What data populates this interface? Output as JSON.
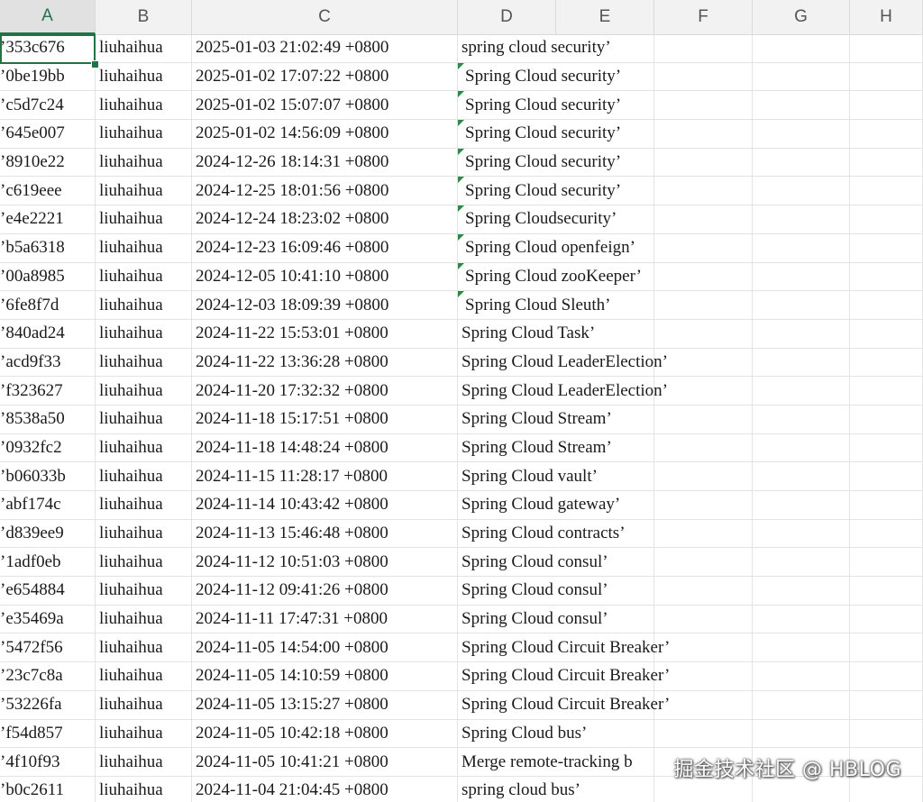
{
  "columns": [
    "A",
    "B",
    "C",
    "D",
    "E",
    "F",
    "G",
    "H"
  ],
  "active_column": "A",
  "rows": [
    {
      "a": "’353c676",
      "b": "liuhaihua",
      "c": "2025-01-03 21:02:49 +0800",
      "d": "spring cloud security’",
      "tri": false
    },
    {
      "a": "’0be19bb",
      "b": "liuhaihua",
      "c": "2025-01-02 17:07:22 +0800",
      "d": "Spring Cloud security’",
      "tri": true
    },
    {
      "a": "’c5d7c24",
      "b": "liuhaihua",
      "c": "2025-01-02 15:07:07 +0800",
      "d": "Spring Cloud security’",
      "tri": true
    },
    {
      "a": "’645e007",
      "b": "liuhaihua",
      "c": "2025-01-02 14:56:09 +0800",
      "d": "Spring Cloud security’",
      "tri": true
    },
    {
      "a": "’8910e22",
      "b": "liuhaihua",
      "c": "2024-12-26 18:14:31 +0800",
      "d": "Spring Cloud security’",
      "tri": true
    },
    {
      "a": "’c619eee",
      "b": "liuhaihua",
      "c": "2024-12-25 18:01:56 +0800",
      "d": "Spring Cloud security’",
      "tri": true
    },
    {
      "a": "’e4e2221",
      "b": "liuhaihua",
      "c": "2024-12-24 18:23:02 +0800",
      "d": "Spring Cloudsecurity’",
      "tri": true
    },
    {
      "a": "’b5a6318",
      "b": "liuhaihua",
      "c": "2024-12-23 16:09:46 +0800",
      "d": "Spring Cloud openfeign’",
      "tri": true
    },
    {
      "a": "’00a8985",
      "b": "liuhaihua",
      "c": "2024-12-05 10:41:10 +0800",
      "d": "Spring Cloud zooKeeper’",
      "tri": true
    },
    {
      "a": "’6fe8f7d",
      "b": "liuhaihua",
      "c": "2024-12-03 18:09:39 +0800",
      "d": "Spring Cloud Sleuth’",
      "tri": true
    },
    {
      "a": "’840ad24",
      "b": "liuhaihua",
      "c": "2024-11-22 15:53:01 +0800",
      "d": "Spring Cloud Task’",
      "tri": false
    },
    {
      "a": "’acd9f33",
      "b": "liuhaihua",
      "c": "2024-11-22 13:36:28 +0800",
      "d": "Spring Cloud LeaderElection’",
      "tri": false
    },
    {
      "a": "’f323627",
      "b": "liuhaihua",
      "c": "2024-11-20 17:32:32 +0800",
      "d": "Spring Cloud LeaderElection’",
      "tri": false
    },
    {
      "a": "’8538a50",
      "b": "liuhaihua",
      "c": "2024-11-18 15:17:51 +0800",
      "d": "Spring Cloud Stream’",
      "tri": false
    },
    {
      "a": "’0932fc2",
      "b": "liuhaihua",
      "c": "2024-11-18 14:48:24 +0800",
      "d": "Spring Cloud Stream’",
      "tri": false
    },
    {
      "a": "’b06033b",
      "b": "liuhaihua",
      "c": "2024-11-15 11:28:17 +0800",
      "d": "Spring Cloud vault’",
      "tri": false
    },
    {
      "a": "’abf174c",
      "b": "liuhaihua",
      "c": "2024-11-14 10:43:42 +0800",
      "d": "Spring Cloud gateway’",
      "tri": false
    },
    {
      "a": "’d839ee9",
      "b": "liuhaihua",
      "c": "2024-11-13 15:46:48 +0800",
      "d": "Spring Cloud contracts’",
      "tri": false
    },
    {
      "a": "’1adf0eb",
      "b": "liuhaihua",
      "c": "2024-11-12 10:51:03 +0800",
      "d": "Spring Cloud consul’",
      "tri": false
    },
    {
      "a": "’e654884",
      "b": "liuhaihua",
      "c": "2024-11-12 09:41:26 +0800",
      "d": "Spring Cloud consul’",
      "tri": false
    },
    {
      "a": "’e35469a",
      "b": "liuhaihua",
      "c": "2024-11-11 17:47:31 +0800",
      "d": "Spring Cloud consul’",
      "tri": false
    },
    {
      "a": "’5472f56",
      "b": "liuhaihua",
      "c": "2024-11-05 14:54:00 +0800",
      "d": "Spring Cloud Circuit Breaker’",
      "tri": false
    },
    {
      "a": "’23c7c8a",
      "b": "liuhaihua",
      "c": "2024-11-05 14:10:59 +0800",
      "d": "Spring Cloud Circuit Breaker’",
      "tri": false
    },
    {
      "a": "’53226fa",
      "b": "liuhaihua",
      "c": "2024-11-05 13:15:27 +0800",
      "d": "Spring Cloud Circuit Breaker’",
      "tri": false
    },
    {
      "a": "’f54d857",
      "b": "liuhaihua",
      "c": "2024-11-05 10:42:18 +0800",
      "d": "Spring Cloud bus’",
      "tri": false
    },
    {
      "a": "’4f10f93",
      "b": "liuhaihua",
      "c": "2024-11-05 10:41:21 +0800",
      "d": "Merge remote-tracking b",
      "tri": false
    },
    {
      "a": "’b0c2611",
      "b": "liuhaihua",
      "c": "2024-11-04 21:04:45 +0800",
      "d": "spring cloud bus’",
      "tri": false
    }
  ],
  "watermark": "掘金技术社区 @ HBLOG",
  "colors": {
    "accent": "#217346",
    "comment_marker": "#2d8a46",
    "header_bg": "#f2f2f2",
    "grid_line": "#e3e3e3"
  }
}
